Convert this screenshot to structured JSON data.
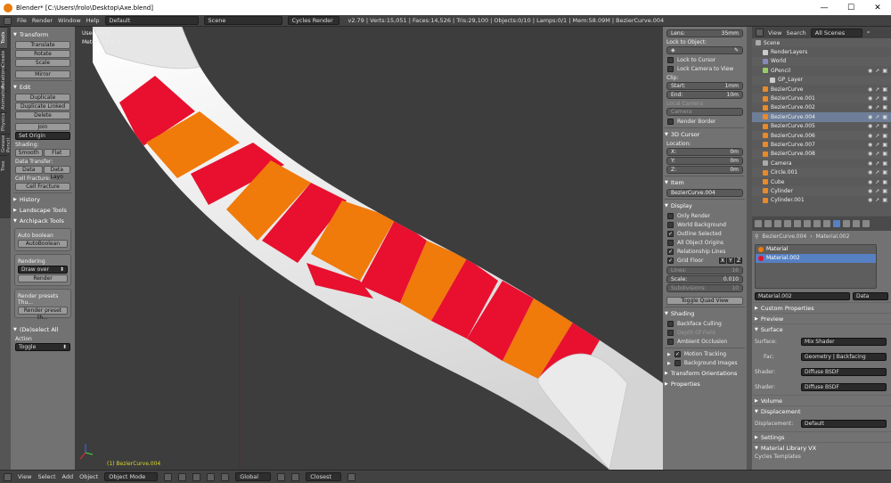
{
  "window": {
    "title": "Blender* [C:\\Users\\frolo\\Desktop\\Axe.blend]"
  },
  "infobar": {
    "menus": [
      "File",
      "Render",
      "Window",
      "Help"
    ],
    "layout": "Default",
    "scene": "Scene",
    "engine": "Cycles Render",
    "stats": "v2.79 | Verts:15,051 | Faces:14,526 | Tris:29,100 | Objects:0/10 | Lamps:0/1 | Mem:58.09M | BezierCurve.004"
  },
  "tabs": [
    "Tools",
    "Create",
    "Relations",
    "Animation",
    "Physics",
    "Grease Pencil",
    "Tree"
  ],
  "toolshelf": {
    "transform_header": "Transform",
    "translate": "Translate",
    "rotate": "Rotate",
    "scale": "Scale",
    "mirror": "Mirror",
    "edit_header": "Edit",
    "duplicate": "Duplicate",
    "duplicate_linked": "Duplicate Linked",
    "delete": "Delete",
    "join": "Join",
    "set_origin": "Set Origin",
    "shading_label": "Shading:",
    "smooth": "Smooth",
    "flat": "Flat",
    "data_transfer_label": "Data Transfer:",
    "data": "Data",
    "data_layout": "Data Layo",
    "cell_fracture_label": "Cell Fracture:",
    "cell_fracture": "Cell Fracture",
    "history": "History",
    "landscape_tools": "Landscape Tools",
    "archipack_tools": "Archipack Tools",
    "auto_boolean_label": "Auto boolean",
    "auto_boolean": "AutoBoolean",
    "rendering_label": "Rendering",
    "draw_over": "Draw over",
    "render": "Render",
    "render_presets_label": "Render presets Thu...",
    "render_preset": "Render preset th...",
    "deselect_header": "(De)select All",
    "action_label": "Action",
    "action_value": "Toggle"
  },
  "viewport": {
    "overlay_line1": "User Persp",
    "overlay_line2": "Meters | 1.0 :1",
    "object_label": "(1) BezierCurve.004",
    "colors": {
      "red": "#e8102e",
      "orange": "#f07a0a",
      "white": "#f2f2f2",
      "grid": "#3d3d3d"
    }
  },
  "npanel": {
    "lens_label": "Lens:",
    "lens_value": "35mm",
    "lock_to_object": "Lock to Object:",
    "lock_to_cursor": "Lock to Cursor",
    "lock_camera_to_view": "Lock Camera to View",
    "clip": "Clip:",
    "start_label": "Start:",
    "start_value": "1mm",
    "end_label": "End:",
    "end_value": "10m",
    "local_camera": "Local Camera",
    "camera": "Camera",
    "render_border": "Render Border",
    "cursor_header": "3D Cursor",
    "location": "Location:",
    "x_label": "X:",
    "x_value": "0m",
    "y_label": "Y:",
    "y_value": "0m",
    "z_label": "Z:",
    "z_value": "0m",
    "item_header": "Item",
    "item_name": "BezierCurve.004",
    "display_header": "Display",
    "only_render": "Only Render",
    "world_background": "World Background",
    "outline_selected": "Outline Selected",
    "all_object_origins": "All Object Origins",
    "relationship_lines": "Relationship Lines",
    "grid_floor": "Grid Floor",
    "axis_x": "X",
    "axis_y": "Y",
    "axis_z": "Z",
    "lines_label": "Lines:",
    "lines_value": "16",
    "scale_label": "Scale:",
    "scale_value": "0.010",
    "subdiv_label": "Subdivisions:",
    "subdiv_value": "10",
    "toggle_quad_view": "Toggle Quad View",
    "shading_header": "Shading",
    "backface_culling": "Backface Culling",
    "depth_of_field": "Depth Of Field",
    "ambient_occlusion": "Ambient Occlusion",
    "motion_tracking": "Motion Tracking",
    "background_images": "Background Images",
    "transform_orientations": "Transform Orientations",
    "properties": "Properties"
  },
  "outliner": {
    "view": "View",
    "search": "Search",
    "scenes": "All Scenes",
    "items": [
      {
        "name": "Scene",
        "depth": 0,
        "icon": "scene-icon"
      },
      {
        "name": "RenderLayers",
        "depth": 1,
        "icon": "renderlayers-icon"
      },
      {
        "name": "World",
        "depth": 1,
        "icon": "world-icon"
      },
      {
        "name": "GPencil",
        "depth": 1,
        "icon": "gpencil-icon"
      },
      {
        "name": "GP_Layer",
        "depth": 2,
        "icon": "layer-icon"
      },
      {
        "name": "BezierCurve",
        "depth": 1,
        "icon": "curve-icon"
      },
      {
        "name": "BezierCurve.001",
        "depth": 1,
        "icon": "curve-icon"
      },
      {
        "name": "BezierCurve.002",
        "depth": 1,
        "icon": "curve-icon"
      },
      {
        "name": "BezierCurve.004",
        "depth": 1,
        "icon": "curve-icon",
        "selected": true
      },
      {
        "name": "BezierCurve.005",
        "depth": 1,
        "icon": "curve-icon"
      },
      {
        "name": "BezierCurve.006",
        "depth": 1,
        "icon": "curve-icon"
      },
      {
        "name": "BezierCurve.007",
        "depth": 1,
        "icon": "curve-icon"
      },
      {
        "name": "BezierCurve.008",
        "depth": 1,
        "icon": "curve-icon"
      },
      {
        "name": "Camera",
        "depth": 1,
        "icon": "camera-icon"
      },
      {
        "name": "Circle.001",
        "depth": 1,
        "icon": "mesh-icon"
      },
      {
        "name": "Cube",
        "depth": 1,
        "icon": "mesh-icon"
      },
      {
        "name": "Cylinder",
        "depth": 1,
        "icon": "mesh-icon"
      },
      {
        "name": "Cylinder.001",
        "depth": 1,
        "icon": "mesh-icon"
      }
    ]
  },
  "properties": {
    "object_name": "BezierCurve.004",
    "material_name": "Material.002",
    "slots": [
      {
        "name": "Material",
        "color": "#f07a0a"
      },
      {
        "name": "Material.002",
        "color": "#e8102e",
        "selected": true
      }
    ],
    "datablock": "Material.002",
    "link_label": "Data",
    "custom_properties": "Custom Properties",
    "preview": "Preview",
    "surface": "Surface",
    "surface_label": "Surface:",
    "surface_value": "Mix Shader",
    "fac_label": "Fac:",
    "fac_value": "Geometry | Backfacing",
    "shader1_label": "Shader:",
    "shader1_value": "Diffuse BSDF",
    "shader2_label": "Shader:",
    "shader2_value": "Diffuse BSDF",
    "volume": "Volume",
    "displacement": "Displacement",
    "displacement_label": "Displacement:",
    "displacement_value": "Default",
    "settings": "Settings",
    "material_library": "Material Library VX",
    "cycles_templates": "Cycles Templates"
  },
  "statusbar": {
    "menus": [
      "View",
      "Select",
      "Add",
      "Object"
    ],
    "mode": "Object Mode",
    "orientation": "Global",
    "snap": "Closest"
  }
}
